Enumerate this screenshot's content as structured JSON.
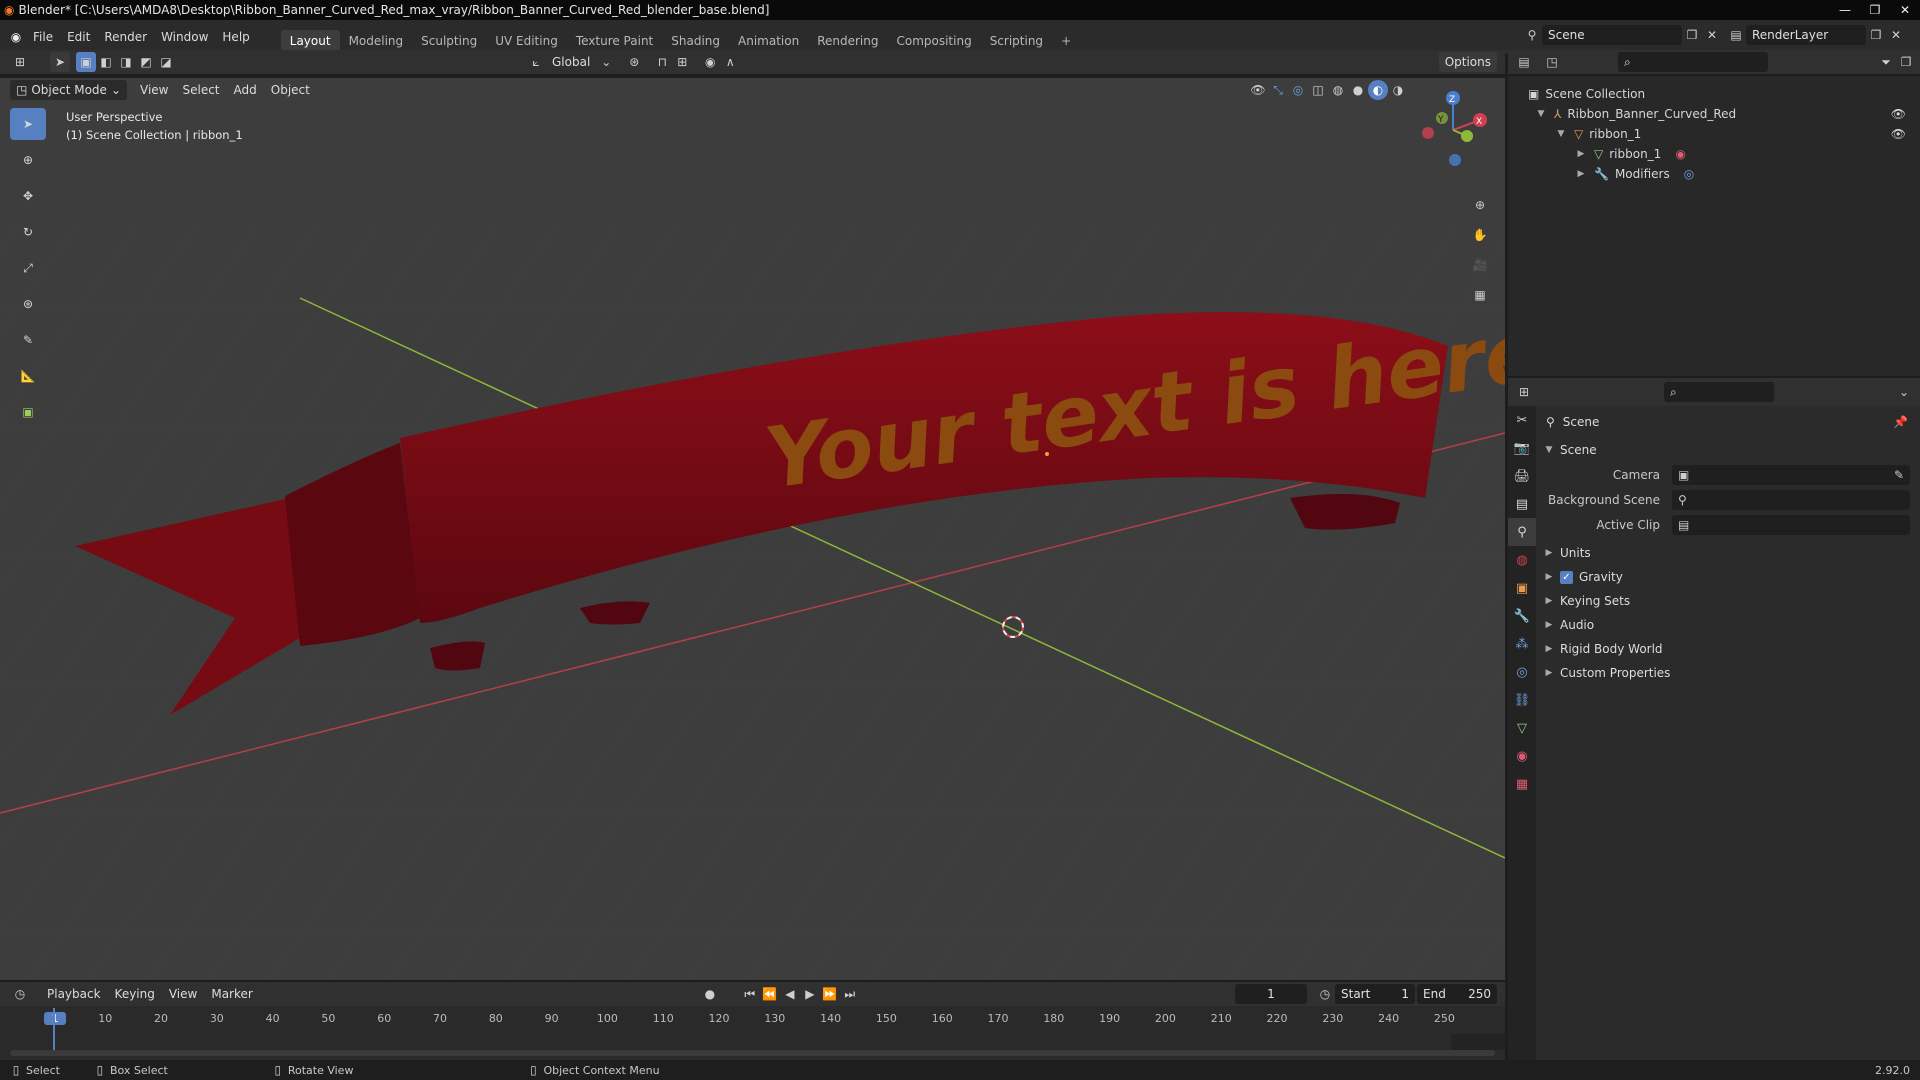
{
  "window": {
    "title": "Blender* [C:\\Users\\AMDA8\\Desktop\\Ribbon_Banner_Curved_Red_max_vray/Ribbon_Banner_Curved_Red_blender_base.blend]",
    "min": "—",
    "max": "❐",
    "close": "✕"
  },
  "menu": {
    "items": [
      "File",
      "Edit",
      "Render",
      "Window",
      "Help"
    ],
    "workspaces": [
      "Layout",
      "Modeling",
      "Sculpting",
      "UV Editing",
      "Texture Paint",
      "Shading",
      "Animation",
      "Rendering",
      "Compositing",
      "Scripting"
    ],
    "active_workspace": "Layout",
    "add_tab": "+",
    "scene": "Scene",
    "view_layer": "RenderLayer"
  },
  "viewport_header": {
    "transform_orientation": "Global",
    "options": "Options",
    "mode": "Object Mode",
    "menus": [
      "View",
      "Select",
      "Add",
      "Object"
    ]
  },
  "viewport": {
    "perspective": "User Perspective",
    "collection": "(1) Scene Collection | ribbon_1",
    "banner_text": "Your text is here",
    "gizmo": {
      "x": "X",
      "y": "Y",
      "z": "Z"
    },
    "colors": {
      "bg": "#3d3d3d",
      "ribbon": "#7a0b14",
      "ribbon_dark": "#5a0710",
      "text": "#8a4a10",
      "x_axis": "#b5404a",
      "y_axis": "#8db83a"
    }
  },
  "tools": [
    "select-box",
    "cursor",
    "move",
    "rotate",
    "scale",
    "transform",
    "annotate",
    "measure",
    "add-cube"
  ],
  "outliner": {
    "root": "Scene Collection",
    "collection": "Ribbon_Banner_Curved_Red",
    "object": "ribbon_1",
    "mesh": "ribbon_1",
    "modifiers": "Modifiers"
  },
  "properties": {
    "context": "Scene",
    "panel": "Scene",
    "fields": [
      {
        "label": "Camera",
        "value": ""
      },
      {
        "label": "Background Scene",
        "value": ""
      },
      {
        "label": "Active Clip",
        "value": ""
      }
    ],
    "sections": [
      "Units",
      "Gravity",
      "Keying Sets",
      "Audio",
      "Rigid Body World",
      "Custom Properties"
    ],
    "gravity_checked": true
  },
  "timeline": {
    "menus": [
      "Playback",
      "Keying",
      "View",
      "Marker"
    ],
    "current_frame": "1",
    "start_label": "Start",
    "start": "1",
    "end_label": "End",
    "end": "250",
    "ticks": [
      "1",
      "10",
      "20",
      "30",
      "40",
      "50",
      "60",
      "70",
      "80",
      "90",
      "100",
      "110",
      "120",
      "130",
      "140",
      "150",
      "160",
      "170",
      "180",
      "190",
      "200",
      "210",
      "220",
      "230",
      "240",
      "250"
    ]
  },
  "status": {
    "select": "Select",
    "box_select": "Box Select",
    "rotate_view": "Rotate View",
    "context_menu": "Object Context Menu",
    "version": "2.92.0"
  }
}
